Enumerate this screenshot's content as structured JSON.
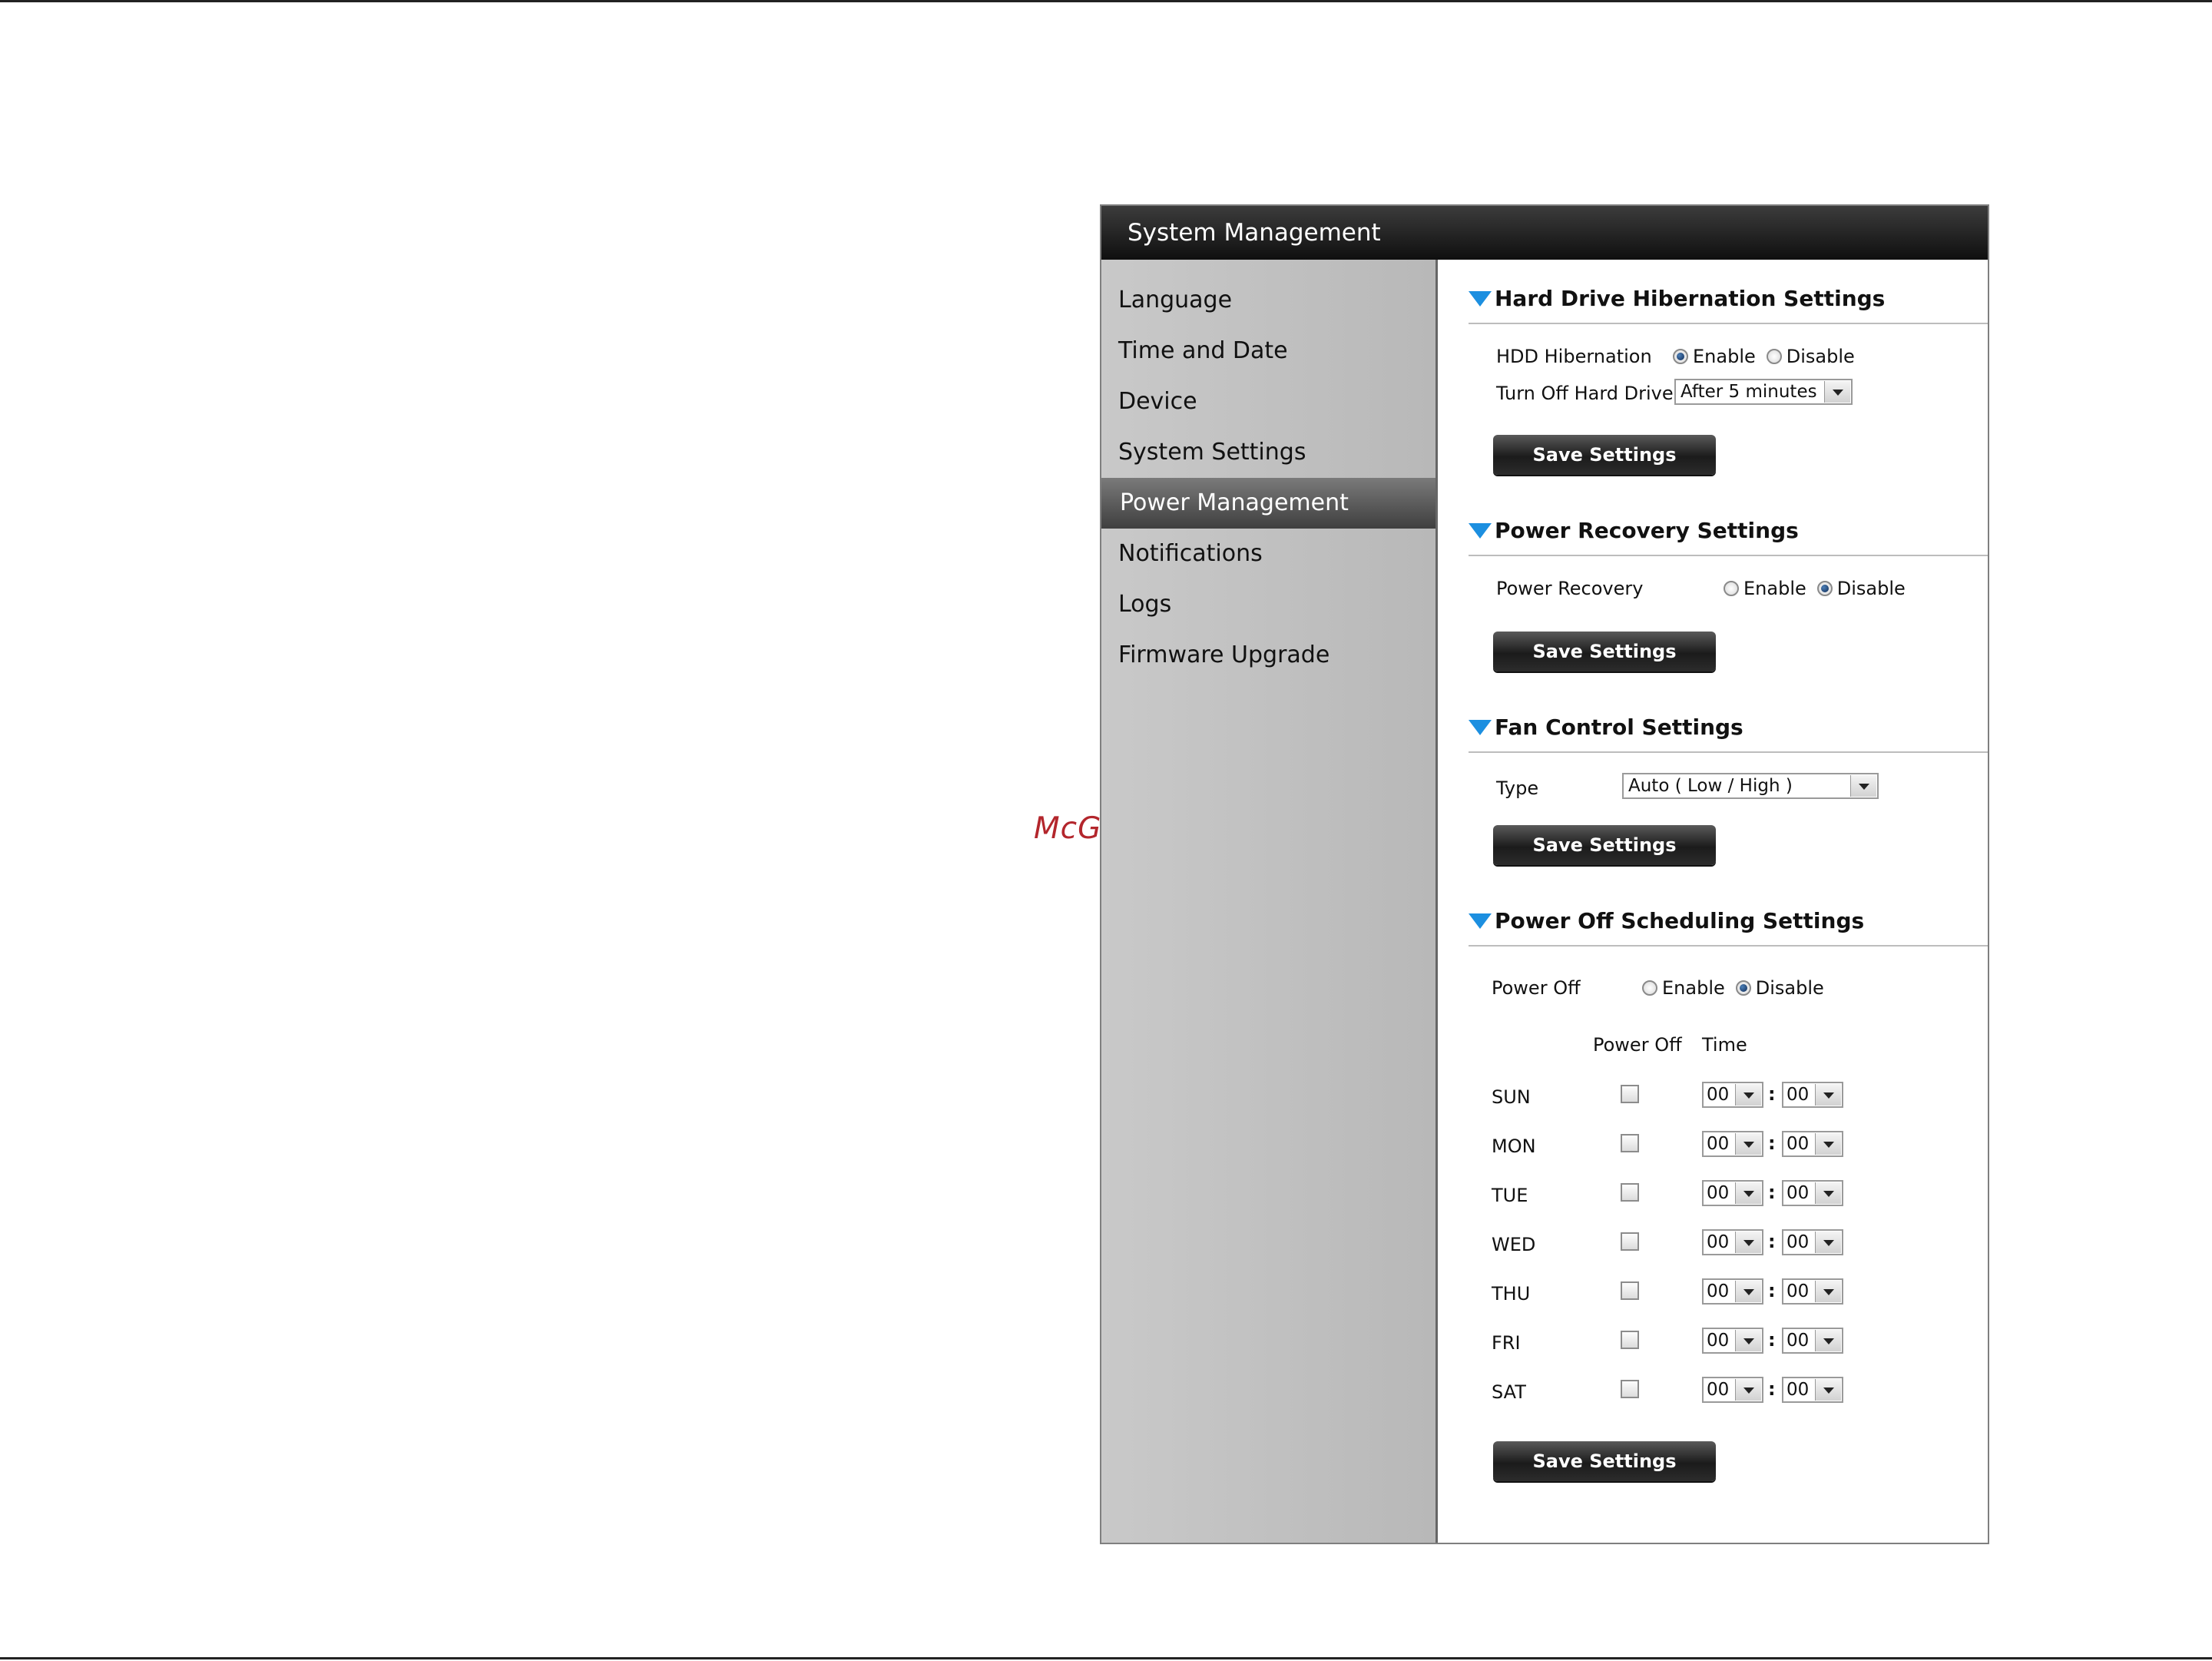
{
  "watermark": "McGrp.Ru",
  "window": {
    "title": "System Management"
  },
  "sidebar": {
    "items": [
      {
        "label": "Language",
        "active": false
      },
      {
        "label": "Time and Date",
        "active": false
      },
      {
        "label": "Device",
        "active": false
      },
      {
        "label": "System Settings",
        "active": false
      },
      {
        "label": "Power Management",
        "active": true
      },
      {
        "label": "Notifications",
        "active": false
      },
      {
        "label": "Logs",
        "active": false
      },
      {
        "label": "Firmware Upgrade",
        "active": false
      }
    ]
  },
  "hibernation": {
    "title": "Hard Drive Hibernation Settings",
    "hdd_label": "HDD Hibernation",
    "enable_label": "Enable",
    "disable_label": "Disable",
    "hdd_selected": "Enable",
    "turnoff_label": "Turn Off Hard Drives",
    "turnoff_value": "After 5 minutes",
    "save_label": "Save Settings"
  },
  "recovery": {
    "title": "Power Recovery Settings",
    "label": "Power Recovery",
    "enable_label": "Enable",
    "disable_label": "Disable",
    "selected": "Disable",
    "save_label": "Save Settings"
  },
  "fan": {
    "title": "Fan Control Settings",
    "type_label": "Type",
    "type_value": "Auto ( Low / High )",
    "save_label": "Save Settings"
  },
  "schedule": {
    "title": "Power Off Scheduling Settings",
    "label": "Power Off",
    "enable_label": "Enable",
    "disable_label": "Disable",
    "selected": "Disable",
    "col_poweroff": "Power Off",
    "col_time": "Time",
    "days": [
      {
        "day": "SUN",
        "checked": false,
        "hour": "00",
        "minute": "00"
      },
      {
        "day": "MON",
        "checked": false,
        "hour": "00",
        "minute": "00"
      },
      {
        "day": "TUE",
        "checked": false,
        "hour": "00",
        "minute": "00"
      },
      {
        "day": "WED",
        "checked": false,
        "hour": "00",
        "minute": "00"
      },
      {
        "day": "THU",
        "checked": false,
        "hour": "00",
        "minute": "00"
      },
      {
        "day": "FRI",
        "checked": false,
        "hour": "00",
        "minute": "00"
      },
      {
        "day": "SAT",
        "checked": false,
        "hour": "00",
        "minute": "00"
      }
    ],
    "time_separator": ":",
    "save_label": "Save Settings"
  },
  "colors": {
    "accent_triangle": "#1c8fe0",
    "titlebar": "#111111",
    "sidebar": "#c4c4c4",
    "watermark": "#b3262c"
  }
}
